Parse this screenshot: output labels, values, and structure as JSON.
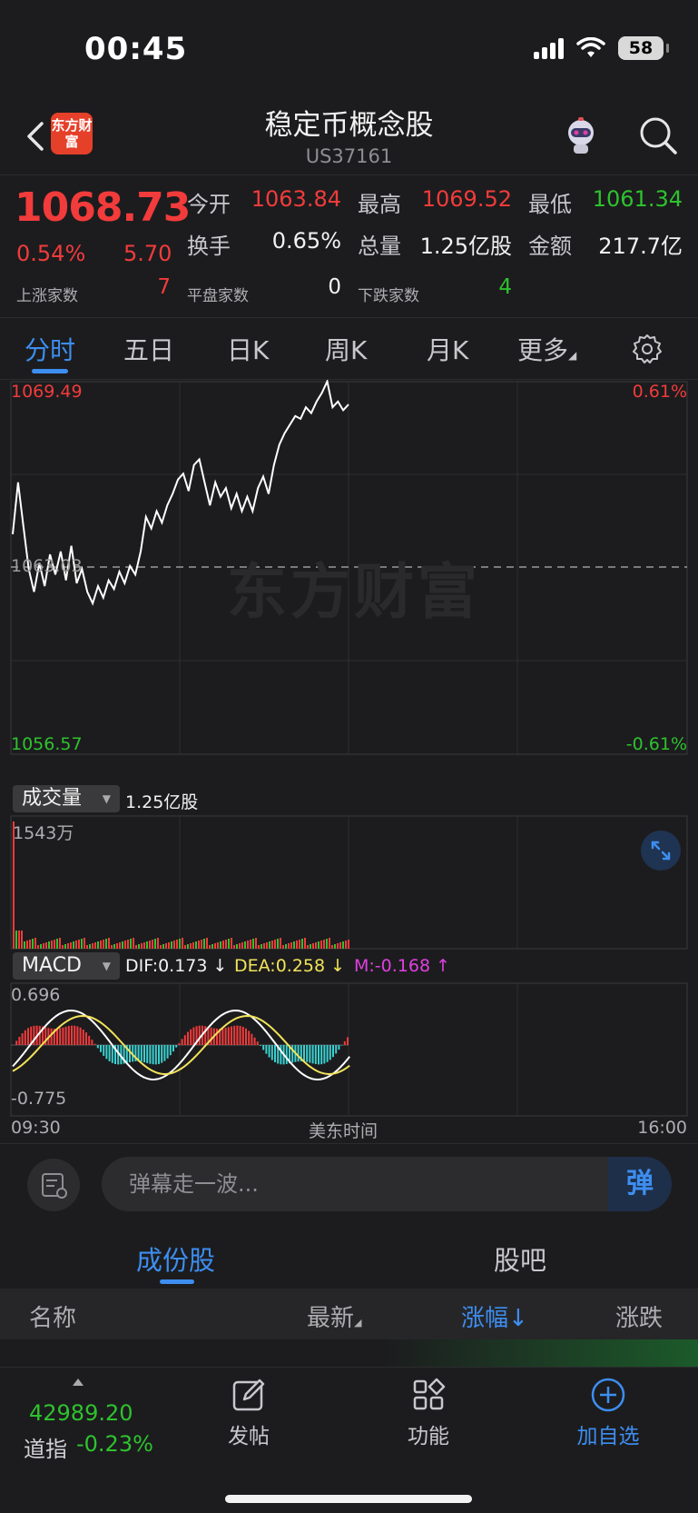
{
  "status_bar": {
    "time": "00:45",
    "battery": "58"
  },
  "header": {
    "title": "稳定币概念股",
    "code": "US37161",
    "logo_text": "东方财富"
  },
  "quote": {
    "price": "1068.73",
    "change_pct": "0.54%",
    "change": "5.70",
    "open_label": "今开",
    "open": "1063.84",
    "high_label": "最高",
    "high": "1069.52",
    "low_label": "最低",
    "low": "1061.34",
    "turnover_label": "换手",
    "turnover": "0.65%",
    "volume_label": "总量",
    "volume": "1.25亿股",
    "amount_label": "金额",
    "amount": "217.7亿",
    "up_count_label": "上涨家数",
    "up_count": "7",
    "flat_count_label": "平盘家数",
    "flat_count": "0",
    "down_count_label": "下跌家数",
    "down_count": "4",
    "colors": {
      "up": "#f23b3b",
      "down": "#2ec22e"
    }
  },
  "tabs": [
    "分时",
    "五日",
    "日K",
    "周K",
    "月K",
    "更多"
  ],
  "active_tab": "分时",
  "chart": {
    "price_max": "1069.49",
    "price_min": "1056.57",
    "pct_max": "0.61%",
    "pct_min": "-0.61%",
    "prev_close": "1063.03",
    "watermark": "东方财富",
    "volume_selector": "成交量",
    "volume_total": "1.25亿股",
    "volume_max": "1543万",
    "macd_selector": "MACD",
    "dif": "DIF:0.173 ↓",
    "dea": "DEA:0.258 ↓",
    "m": "M:-0.168 ↑",
    "macd_max": "0.696",
    "macd_min": "-0.775",
    "time_start": "09:30",
    "time_mid": "美东时间",
    "time_end": "16:00"
  },
  "chart_data": {
    "type": "line",
    "title": "",
    "y_range": [
      1056.57,
      1069.49
    ],
    "reference_line": 1063.03,
    "x": [
      "09:30",
      "16:00"
    ],
    "series": [
      {
        "values": [
          1064.2,
          1066.0,
          1064.5,
          1063.0,
          1062.2,
          1063.2,
          1062.4,
          1063.5,
          1062.8,
          1063.6,
          1062.6,
          1063.8,
          1062.5,
          1063.0,
          1062.2,
          1061.8,
          1062.4,
          1062.0,
          1062.6,
          1062.3,
          1062.9,
          1062.5,
          1063.1,
          1062.8,
          1063.6,
          1064.8,
          1064.4,
          1065.0,
          1064.6,
          1065.2,
          1065.6,
          1066.1,
          1066.3,
          1065.7,
          1066.6,
          1066.8,
          1066.0,
          1065.2,
          1066.0,
          1065.5,
          1065.8,
          1065.1,
          1065.6,
          1065.0,
          1065.5,
          1065.0,
          1065.8,
          1066.2,
          1065.6,
          1066.6,
          1067.3,
          1067.7,
          1068.0,
          1068.3,
          1068.2,
          1068.6,
          1068.4,
          1068.8,
          1069.1,
          1069.5,
          1068.6,
          1068.8,
          1068.5,
          1068.7
        ]
      }
    ]
  },
  "danmu": {
    "placeholder": "弹幕走一波...",
    "button": "弹"
  },
  "sub_tabs": [
    "成份股",
    "股吧"
  ],
  "table_headers": {
    "name": "名称",
    "latest": "最新",
    "change_pct": "涨幅↓",
    "change": "涨跌"
  },
  "bottom_nav": {
    "index_value": "42989.20",
    "index_name": "道指",
    "index_pct": "-0.23%",
    "post": "发帖",
    "features": "功能",
    "add_watch": "加自选"
  }
}
